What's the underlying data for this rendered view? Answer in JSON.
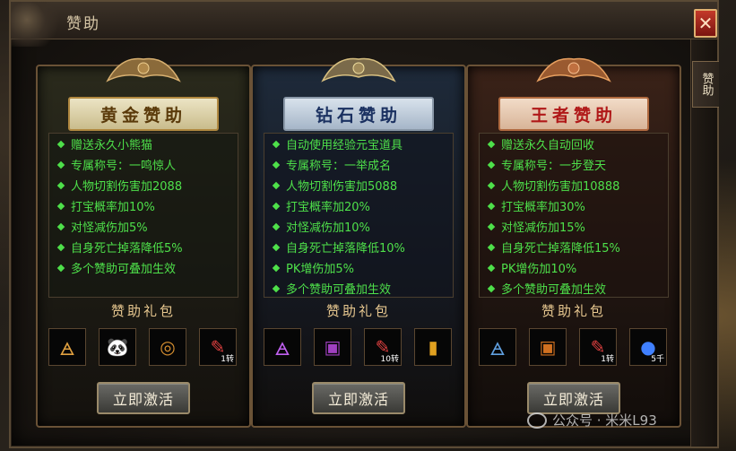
{
  "window": {
    "title": "赞助",
    "close_glyph": "✕",
    "side_tab": "赞助"
  },
  "panels": [
    {
      "id": "gold",
      "title": "黄金赞助",
      "features": [
        "赠送永久小熊猫",
        "专属称号：一鸣惊人",
        "人物切割伤害加2088",
        "打宝概率加10%",
        "对怪减伤加5%",
        "自身死亡掉落降低5%",
        "多个赞助可叠加生效"
      ],
      "pack_title": "赞助礼包",
      "items": [
        {
          "icon": "wing-icon",
          "glyph": "🜁",
          "count": ""
        },
        {
          "icon": "panda-icon",
          "glyph": "🐼",
          "count": ""
        },
        {
          "icon": "medal-icon",
          "glyph": "◎",
          "count": ""
        },
        {
          "icon": "scroll-icon",
          "glyph": "✎",
          "count": "1转"
        }
      ],
      "button": "立即激活"
    },
    {
      "id": "diamond",
      "title": "钻石赞助",
      "features": [
        "自动使用经验元宝道具",
        "专属称号：一举成名",
        "人物切割伤害加5088",
        "打宝概率加20%",
        "对怪减伤加10%",
        "自身死亡掉落降低10%",
        "PK增伤加5%",
        "多个赞助可叠加生效"
      ],
      "pack_title": "赞助礼包",
      "items": [
        {
          "icon": "wing-icon",
          "glyph": "🜁",
          "count": ""
        },
        {
          "icon": "treasure-chest-icon",
          "glyph": "▣",
          "count": ""
        },
        {
          "icon": "scroll-icon",
          "glyph": "✎",
          "count": "10转"
        },
        {
          "icon": "gold-card-icon",
          "glyph": "▮",
          "count": ""
        }
      ],
      "button": "立即激活"
    },
    {
      "id": "king",
      "title": "王者赞助",
      "features": [
        "赠送永久自动回收",
        "专属称号：一步登天",
        "人物切割伤害加10888",
        "打宝概率加30%",
        "对怪减伤加15%",
        "自身死亡掉落降低15%",
        "PK增伤加10%",
        "多个赞助可叠加生效"
      ],
      "pack_title": "赞助礼包",
      "items": [
        {
          "icon": "wing-icon",
          "glyph": "🜁",
          "count": ""
        },
        {
          "icon": "treasure-chest-icon",
          "glyph": "▣",
          "count": ""
        },
        {
          "icon": "scroll-icon",
          "glyph": "✎",
          "count": "1转"
        },
        {
          "icon": "orb-icon",
          "glyph": "●",
          "count": "5千"
        }
      ],
      "button": "立即激活"
    }
  ],
  "watermark": "公众号 · 米米L93",
  "colors": {
    "feature_text": "#4ee04a",
    "gold_title": "#5a3a0a",
    "diamond_title": "#1a3060",
    "king_title": "#b01818",
    "close_bg": "#c43a2a"
  }
}
